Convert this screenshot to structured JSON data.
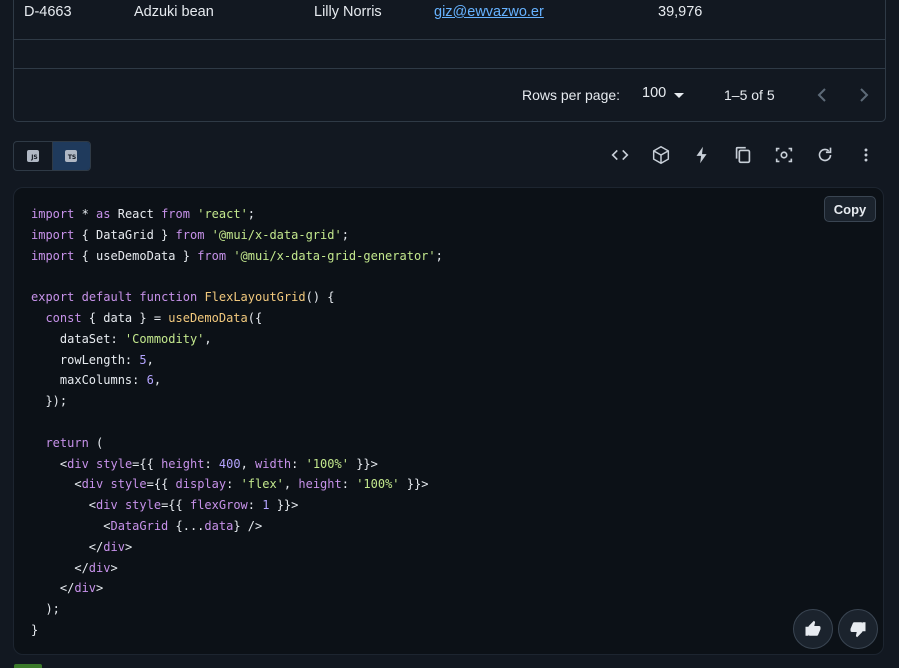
{
  "grid": {
    "row": {
      "id": "D-4663",
      "commodity": "Adzuki bean",
      "trader": "Lilly Norris",
      "email": "giz@ewvazwo.er",
      "quantity": "39,976"
    },
    "footer": {
      "rows_per_page_label": "Rows per page:",
      "rows_per_page_value": "100",
      "range": "1–5 of 5"
    }
  },
  "toolbar": {
    "languages": [
      {
        "label": "JS",
        "selected": false
      },
      {
        "label": "TS",
        "selected": true
      }
    ],
    "icons": [
      "code-icon",
      "codesandbox-icon",
      "stackblitz-bolt-icon",
      "copy-icon",
      "screenshot-icon",
      "reset-icon",
      "more-vert-icon"
    ]
  },
  "code": {
    "copy_label": "Copy",
    "lines": [
      [
        [
          "kw",
          "import"
        ],
        [
          "p",
          " * "
        ],
        [
          "kw",
          "as"
        ],
        [
          "p",
          " React "
        ],
        [
          "kw",
          "from"
        ],
        [
          "p",
          " "
        ],
        [
          "str",
          "'react'"
        ],
        [
          "p",
          ";"
        ]
      ],
      [
        [
          "kw",
          "import"
        ],
        [
          "p",
          " { DataGrid } "
        ],
        [
          "kw",
          "from"
        ],
        [
          "p",
          " "
        ],
        [
          "str",
          "'@mui/x-data-grid'"
        ],
        [
          "p",
          ";"
        ]
      ],
      [
        [
          "kw",
          "import"
        ],
        [
          "p",
          " { useDemoData } "
        ],
        [
          "kw",
          "from"
        ],
        [
          "p",
          " "
        ],
        [
          "str",
          "'@mui/x-data-grid-generator'"
        ],
        [
          "p",
          ";"
        ]
      ],
      [],
      [
        [
          "kw",
          "export"
        ],
        [
          "p",
          " "
        ],
        [
          "kw",
          "default"
        ],
        [
          "p",
          " "
        ],
        [
          "kw",
          "function"
        ],
        [
          "p",
          " "
        ],
        [
          "fn",
          "FlexLayoutGrid"
        ],
        [
          "p",
          "() {"
        ]
      ],
      [
        [
          "p",
          "  "
        ],
        [
          "kw",
          "const"
        ],
        [
          "p",
          " { data } = "
        ],
        [
          "fn",
          "useDemoData"
        ],
        [
          "p",
          "({"
        ]
      ],
      [
        [
          "p",
          "    dataSet: "
        ],
        [
          "str",
          "'Commodity'"
        ],
        [
          "p",
          ","
        ]
      ],
      [
        [
          "p",
          "    rowLength: "
        ],
        [
          "num",
          "5"
        ],
        [
          "p",
          ","
        ]
      ],
      [
        [
          "p",
          "    maxColumns: "
        ],
        [
          "num",
          "6"
        ],
        [
          "p",
          ","
        ]
      ],
      [
        [
          "p",
          "  });"
        ]
      ],
      [],
      [
        [
          "p",
          "  "
        ],
        [
          "kw",
          "return"
        ],
        [
          "p",
          " ("
        ]
      ],
      [
        [
          "p",
          "    <"
        ],
        [
          "tag",
          "div"
        ],
        [
          "p",
          " "
        ],
        [
          "attr",
          "style"
        ],
        [
          "p",
          "={{ "
        ],
        [
          "attr",
          "height"
        ],
        [
          "p",
          ": "
        ],
        [
          "num",
          "400"
        ],
        [
          "p",
          ", "
        ],
        [
          "attr",
          "width"
        ],
        [
          "p",
          ": "
        ],
        [
          "str",
          "'100%'"
        ],
        [
          "p",
          " }}>"
        ]
      ],
      [
        [
          "p",
          "      <"
        ],
        [
          "tag",
          "div"
        ],
        [
          "p",
          " "
        ],
        [
          "attr",
          "style"
        ],
        [
          "p",
          "={{ "
        ],
        [
          "attr",
          "display"
        ],
        [
          "p",
          ": "
        ],
        [
          "str",
          "'flex'"
        ],
        [
          "p",
          ", "
        ],
        [
          "attr",
          "height"
        ],
        [
          "p",
          ": "
        ],
        [
          "str",
          "'100%'"
        ],
        [
          "p",
          " }}>"
        ]
      ],
      [
        [
          "p",
          "        <"
        ],
        [
          "tag",
          "div"
        ],
        [
          "p",
          " "
        ],
        [
          "attr",
          "style"
        ],
        [
          "p",
          "={{ "
        ],
        [
          "attr",
          "flexGrow"
        ],
        [
          "p",
          ": "
        ],
        [
          "num",
          "1"
        ],
        [
          "p",
          " }}>"
        ]
      ],
      [
        [
          "p",
          "          <"
        ],
        [
          "tag",
          "DataGrid"
        ],
        [
          "p",
          " {..."
        ],
        [
          "attr",
          "data"
        ],
        [
          "p",
          "} />"
        ]
      ],
      [
        [
          "p",
          "        </"
        ],
        [
          "tag",
          "div"
        ],
        [
          "p",
          ">"
        ]
      ],
      [
        [
          "p",
          "      </"
        ],
        [
          "tag",
          "div"
        ],
        [
          "p",
          ">"
        ]
      ],
      [
        [
          "p",
          "    </"
        ],
        [
          "tag",
          "div"
        ],
        [
          "p",
          ">"
        ]
      ],
      [
        [
          "p",
          "  );"
        ]
      ],
      [
        [
          "p",
          "}"
        ]
      ]
    ]
  },
  "feedback": {
    "up_icon": "thumb-up-icon",
    "down_icon": "thumb-down-icon"
  },
  "colors": {
    "background": "#121821",
    "code_background": "#0c1117",
    "link": "#66b2ff",
    "keyword": "#c792ea",
    "string": "#c3e88d",
    "number": "#b4a4ff",
    "function": "#f2c97d"
  }
}
